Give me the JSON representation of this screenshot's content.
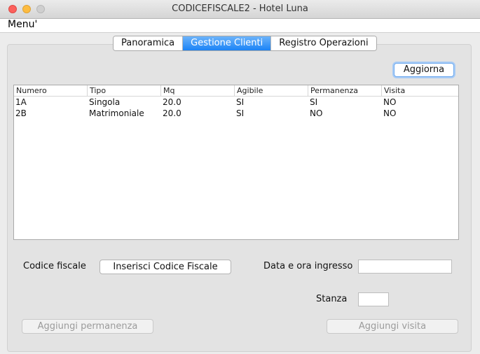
{
  "window": {
    "title": "CODICEFISCALE2 - Hotel Luna"
  },
  "menubar": {
    "menu_label": "Menu'"
  },
  "tabs": [
    {
      "label": "Panoramica"
    },
    {
      "label": "Gestione Clienti"
    },
    {
      "label": "Registro Operazioni"
    }
  ],
  "active_tab": "Gestione Clienti",
  "toolbar": {
    "refresh_label": "Aggiorna"
  },
  "table": {
    "columns": [
      "Numero",
      "Tipo",
      "Mq",
      "Agibile",
      "Permanenza",
      "Visita"
    ],
    "rows": [
      [
        "1A",
        "Singola",
        "20.0",
        "SI",
        "SI",
        "NO"
      ],
      [
        "2B",
        "Matrimoniale",
        "20.0",
        "SI",
        "NO",
        "NO"
      ]
    ]
  },
  "form": {
    "codice_label": "Codice fiscale",
    "insert_codice_label": "Inserisci Codice Fiscale",
    "data_label": "Data e ora ingresso",
    "data_value": "",
    "stanza_label": "Stanza",
    "stanza_value": "",
    "add_permanenza_label": "Aggiungi permanenza",
    "add_visita_label": "Aggiungi visita"
  },
  "colors": {
    "accent": "#1b83f6",
    "close": "#fc605c",
    "minimize": "#fdbc40"
  }
}
